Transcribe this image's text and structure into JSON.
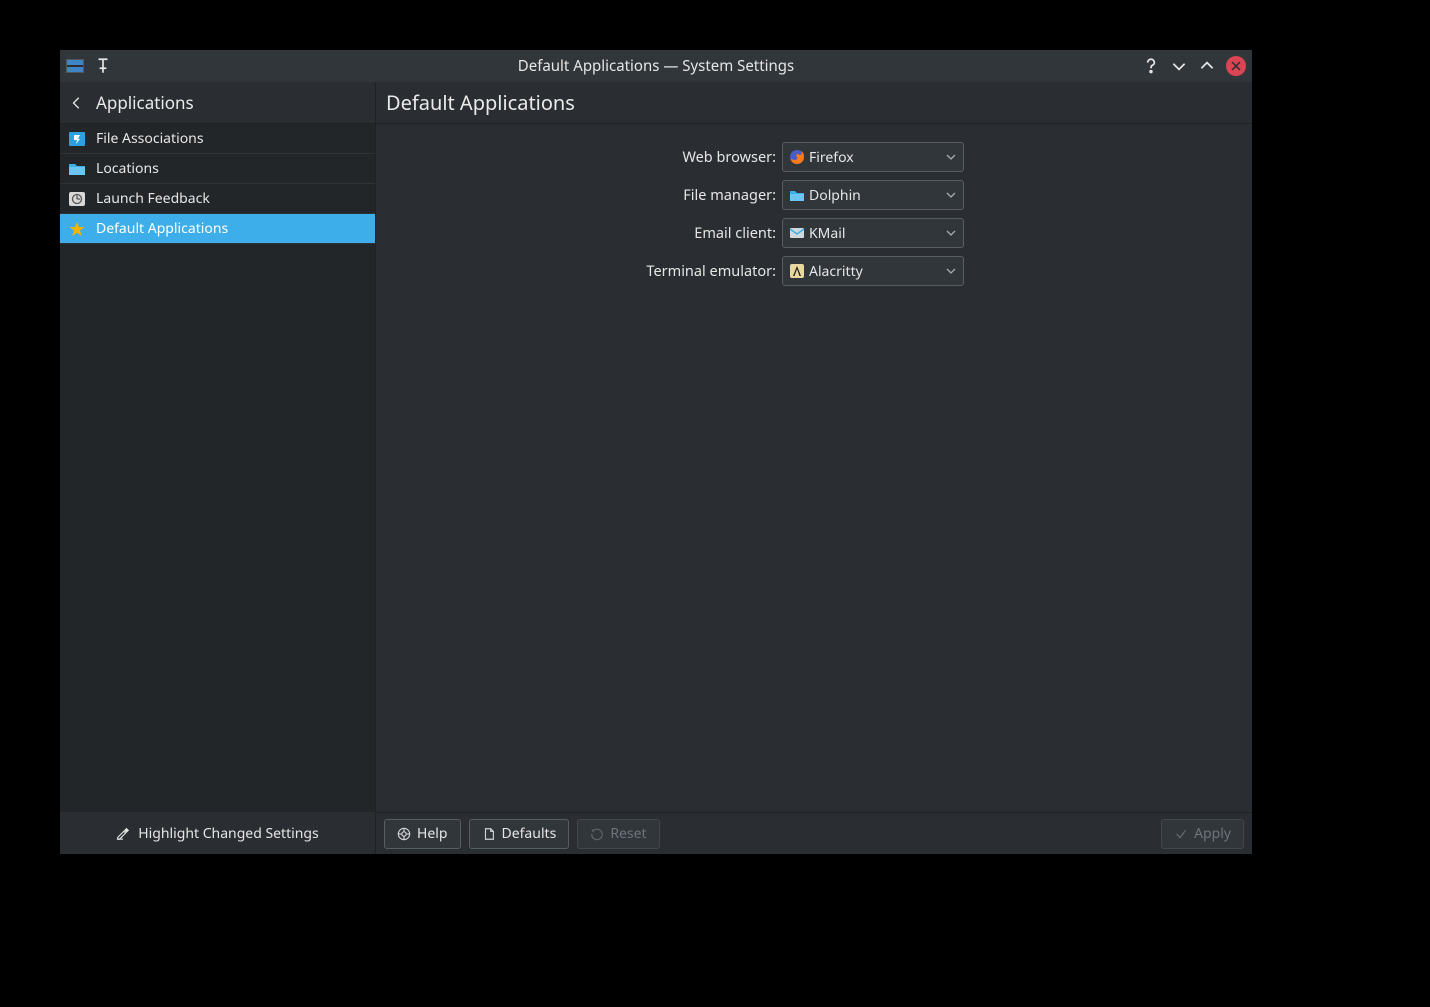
{
  "window_title": "Default Applications — System Settings",
  "sidebar": {
    "header": "Applications",
    "items": [
      {
        "label": "File Associations"
      },
      {
        "label": "Locations"
      },
      {
        "label": "Launch Feedback"
      },
      {
        "label": "Default Applications"
      }
    ],
    "highlight_link": "Highlight Changed Settings"
  },
  "main": {
    "title": "Default Applications",
    "rows": [
      {
        "label": "Web browser:",
        "value": "Firefox"
      },
      {
        "label": "File manager:",
        "value": "Dolphin"
      },
      {
        "label": "Email client:",
        "value": "KMail"
      },
      {
        "label": "Terminal emulator:",
        "value": "Alacritty"
      }
    ]
  },
  "footer": {
    "help": "Help",
    "defaults": "Defaults",
    "reset": "Reset",
    "apply": "Apply"
  }
}
